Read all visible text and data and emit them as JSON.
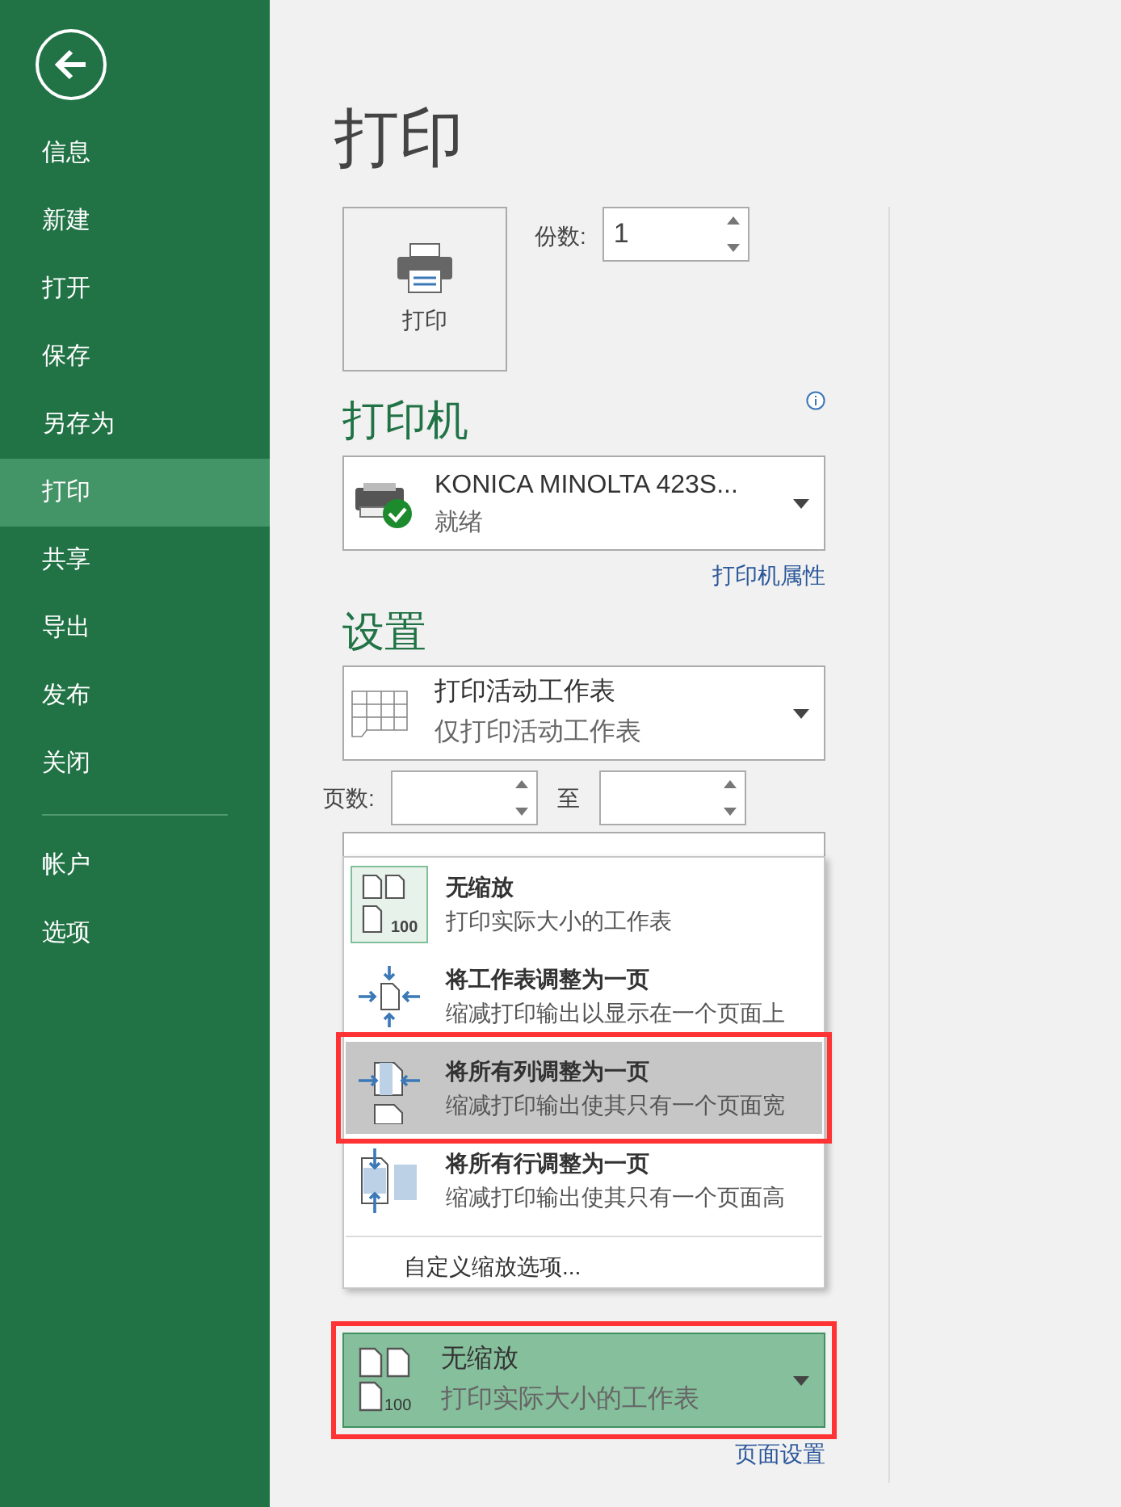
{
  "sidebar": {
    "items": [
      {
        "label": "信息",
        "selected": false
      },
      {
        "label": "新建",
        "selected": false
      },
      {
        "label": "打开",
        "selected": false
      },
      {
        "label": "保存",
        "selected": false
      },
      {
        "label": "另存为",
        "selected": false
      },
      {
        "label": "打印",
        "selected": true
      },
      {
        "label": "共享",
        "selected": false
      },
      {
        "label": "导出",
        "selected": false
      },
      {
        "label": "发布",
        "selected": false
      },
      {
        "label": "关闭",
        "selected": false
      }
    ],
    "footer_items": [
      {
        "label": "帐户",
        "selected": false
      },
      {
        "label": "选项",
        "selected": false
      }
    ]
  },
  "title": "打印",
  "print_button": {
    "label": "打印"
  },
  "copies": {
    "label": "份数:",
    "value": "1"
  },
  "printer": {
    "heading": "打印机",
    "name": "KONICA MINOLTA 423S...",
    "status": "就绪",
    "properties_link": "打印机属性"
  },
  "settings": {
    "heading": "设置",
    "print_what": {
      "title": "打印活动工作表",
      "subtitle": "仅打印活动工作表"
    },
    "pages": {
      "label": "页数:",
      "to_label": "至"
    },
    "scaling_menu": {
      "items": [
        {
          "kind": "none",
          "title": "无缩放",
          "subtitle": "打印实际大小的工作表",
          "icon_label": "100",
          "selected": true,
          "hovered": false,
          "annotated": false
        },
        {
          "kind": "fit_sheet",
          "title": "将工作表调整为一页",
          "subtitle": "缩减打印输出以显示在一个页面上",
          "selected": false,
          "hovered": false,
          "annotated": false
        },
        {
          "kind": "fit_columns",
          "title": "将所有列调整为一页",
          "subtitle": "缩减打印输出使其只有一个页面宽",
          "selected": false,
          "hovered": true,
          "annotated": true
        },
        {
          "kind": "fit_rows",
          "title": "将所有行调整为一页",
          "subtitle": "缩减打印输出使其只有一个页面高",
          "selected": false,
          "hovered": false,
          "annotated": false
        }
      ],
      "custom_link": "自定义缩放选项..."
    },
    "scaling": {
      "title": "无缩放",
      "subtitle": "打印实际大小的工作表",
      "icon_label": "100",
      "annotated": true
    },
    "page_setup_link": "页面设置"
  }
}
